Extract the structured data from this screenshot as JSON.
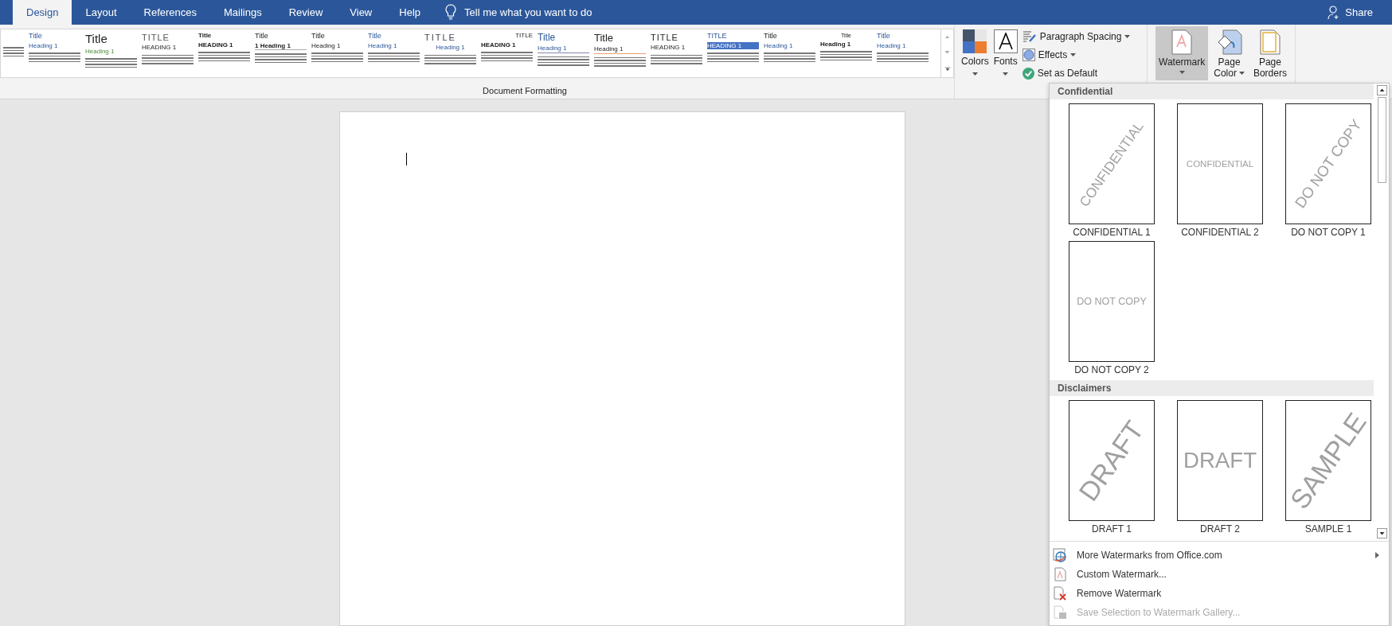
{
  "tabs": [
    {
      "label": "Design",
      "selected": true
    },
    {
      "label": "Layout",
      "selected": false
    },
    {
      "label": "References",
      "selected": false
    },
    {
      "label": "Mailings",
      "selected": false
    },
    {
      "label": "Review",
      "selected": false
    },
    {
      "label": "View",
      "selected": false
    },
    {
      "label": "Help",
      "selected": false
    }
  ],
  "tell_me": "Tell me what you want to do",
  "share": "Share",
  "style_gallery": {
    "items": [
      {
        "title": "Title",
        "heading": "Heading 1"
      },
      {
        "title": "Title",
        "heading": "Heading 1"
      },
      {
        "title": "TITLE",
        "heading": "HEADING 1"
      },
      {
        "title": "Title",
        "heading": "HEADING 1"
      },
      {
        "title": "Title",
        "heading": "1   Heading 1"
      },
      {
        "title": "Title",
        "heading": "Heading 1"
      },
      {
        "title": "Title",
        "heading": "Heading 1"
      },
      {
        "title": "TITLE",
        "heading": "Heading 1"
      },
      {
        "title": "TITLE",
        "heading": "HEADING 1"
      },
      {
        "title": "Title",
        "heading": "Heading 1"
      },
      {
        "title": "Title",
        "heading": "Heading 1"
      },
      {
        "title": "TITLE",
        "heading": "HEADING 1"
      },
      {
        "title": "TITLE",
        "heading": "HEADING 1"
      },
      {
        "title": "Title",
        "heading": "Heading 1"
      },
      {
        "title": "Title",
        "heading": "Heading 1"
      },
      {
        "title": "Title",
        "heading": "Heading 1"
      }
    ],
    "group_label": "Document Formatting"
  },
  "colors_button": "Colors",
  "fonts_button": "Fonts",
  "paragraph_spacing": "Paragraph Spacing",
  "effects": "Effects",
  "set_as_default": "Set as Default",
  "watermark_button": {
    "label": "Watermark",
    "selected": true
  },
  "page_color_button": {
    "line1": "Page",
    "line2": "Color"
  },
  "page_borders_button": {
    "line1": "Page",
    "line2": "Borders"
  },
  "watermark_menu": {
    "sections": [
      {
        "title": "Confidential",
        "items": [
          {
            "label": "CONFIDENTIAL 1",
            "preview": "CONFIDENTIAL",
            "diagonal": true
          },
          {
            "label": "CONFIDENTIAL 2",
            "preview": "CONFIDENTIAL",
            "diagonal": false
          },
          {
            "label": "DO NOT COPY 1",
            "preview": "DO NOT COPY",
            "diagonal": true
          },
          {
            "label": "DO NOT COPY 2",
            "preview": "DO NOT COPY",
            "diagonal": false
          }
        ]
      },
      {
        "title": "Disclaimers",
        "items": [
          {
            "label": "DRAFT 1",
            "preview": "DRAFT",
            "diagonal": true
          },
          {
            "label": "DRAFT 2",
            "preview": "DRAFT",
            "diagonal": false
          },
          {
            "label": "SAMPLE 1",
            "preview": "SAMPLE",
            "diagonal": true
          }
        ]
      }
    ],
    "commands": [
      {
        "label": "More Watermarks from Office.com",
        "kind": "globe",
        "submenu": true,
        "disabled": false
      },
      {
        "label": "Custom Watermark...",
        "kind": "custom",
        "submenu": false,
        "disabled": false
      },
      {
        "label": "Remove Watermark",
        "kind": "remove",
        "submenu": false,
        "disabled": false
      },
      {
        "label": "Save Selection to Watermark Gallery...",
        "kind": "save",
        "submenu": false,
        "disabled": true
      }
    ]
  }
}
